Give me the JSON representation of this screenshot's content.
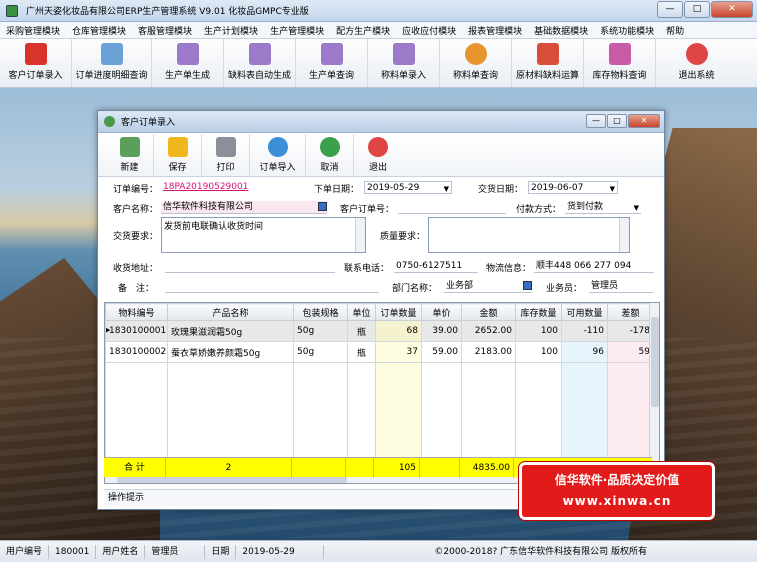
{
  "app": {
    "title": "广州天姿化妆品有限公司ERP生产管理系统  V9.01 化妆品GMPC专业版",
    "win_min": "—",
    "win_max": "□",
    "win_close": "✕"
  },
  "menu": [
    "采购管理模块",
    "仓库管理模块",
    "客服管理模块",
    "生产计划模块",
    "生产管理模块",
    "配方生产模块",
    "应收应付模块",
    "报表管理模块",
    "基础数据模块",
    "系统功能模块",
    "帮助"
  ],
  "toolbar": [
    {
      "label": "客户订单录入",
      "icon": "pdf-document-icon",
      "color": "#d9342b"
    },
    {
      "label": "订单进度明细查询",
      "icon": "document-list-icon",
      "color": "#6aa2d8"
    },
    {
      "label": "生产单生成",
      "icon": "feather-pen-icon",
      "color": "#9a7ac9"
    },
    {
      "label": "缺料表自动生成",
      "icon": "feather-pen-icon",
      "color": "#9a7ac9"
    },
    {
      "label": "生产单查询",
      "icon": "feather-pen-icon",
      "color": "#9a7ac9"
    },
    {
      "label": "称料单录入",
      "icon": "feather-pen-icon",
      "color": "#9a7ac9"
    },
    {
      "label": "称料单查询",
      "icon": "flower-icon",
      "color": "#e8952d"
    },
    {
      "label": "原材料缺料运算",
      "icon": "quill-icon",
      "color": "#d94e3a"
    },
    {
      "label": "库存物料查询",
      "icon": "quill-icon",
      "color": "#c85aa8"
    },
    {
      "label": "退出系统",
      "icon": "power-icon",
      "color": "#e04545"
    }
  ],
  "child_window": {
    "title": "客户订单录入",
    "buttons": [
      {
        "label": "新建",
        "icon": "new-document-icon",
        "color": "#5aa05a"
      },
      {
        "label": "保存",
        "icon": "save-icon",
        "color": "#f0b81e"
      },
      {
        "label": "打印",
        "icon": "printer-icon",
        "color": "#8a8f99"
      },
      {
        "label": "订单导入",
        "icon": "import-icon",
        "color": "#3b8fd6"
      },
      {
        "label": "取消",
        "icon": "undo-icon",
        "color": "#3aa04a"
      },
      {
        "label": "退出",
        "icon": "power-icon",
        "color": "#e04545"
      }
    ]
  },
  "form": {
    "order_no_label": "订单编号：",
    "order_no": "18PA20190529001",
    "order_date_label": "下单日期：",
    "order_date": "2019-05-29",
    "delivery_date_label": "交货日期：",
    "delivery_date": "2019-06-07",
    "customer_label": "客户名称：",
    "customer": "信华软件科技有限公司",
    "cust_order_label": "客户订单号：",
    "cust_order": "",
    "payment_label": "付款方式：",
    "payment": "货到付款",
    "delivery_req_label": "交货要求：",
    "delivery_req": "发货前电联确认收货时间",
    "quality_req_label": "质量要求：",
    "quality_req": "",
    "address_label": "收货地址：",
    "address": "",
    "phone_label": "联系电话：",
    "phone": "0750-6127511",
    "logistics_label": "物流信息：",
    "logistics": "顺丰448 066 277 094",
    "remark_label": "备　注：",
    "remark": "",
    "dept_label": "部门名称：",
    "dept": "业务部",
    "salesman_label": "业务员：",
    "salesman": "管理员"
  },
  "grid": {
    "headers": [
      "物料编号",
      "产品名称",
      "包装规格",
      "单位",
      "订单数量",
      "单价",
      "金额",
      "库存数量",
      "可用数量",
      "差额"
    ],
    "rows": [
      [
        "1830100001",
        "玫瑰果滋润霜50g",
        "50g",
        "瓶",
        "68",
        "39.00",
        "2652.00",
        "100",
        "-110",
        "-178"
      ],
      [
        "1830100002",
        "蚕衣草娇嫩养颜霜50g",
        "50g",
        "瓶",
        "37",
        "59.00",
        "2183.00",
        "100",
        "96",
        "59"
      ]
    ],
    "total": {
      "label": "合 计",
      "count": "2",
      "qty": "105",
      "amount": "4835.00"
    }
  },
  "hint": "操作提示",
  "banner": {
    "line1": "信华软件·品质决定价值",
    "line2": "www.xinwa.cn"
  },
  "status": [
    {
      "label": "用户编号",
      "value": "180001"
    },
    {
      "label": "用户姓名",
      "value": "管理员"
    },
    {
      "label": "日期",
      "value": "2019-05-29"
    }
  ],
  "copyright": "©2000-2018?  广东信华软件科技有限公司    版权所有"
}
